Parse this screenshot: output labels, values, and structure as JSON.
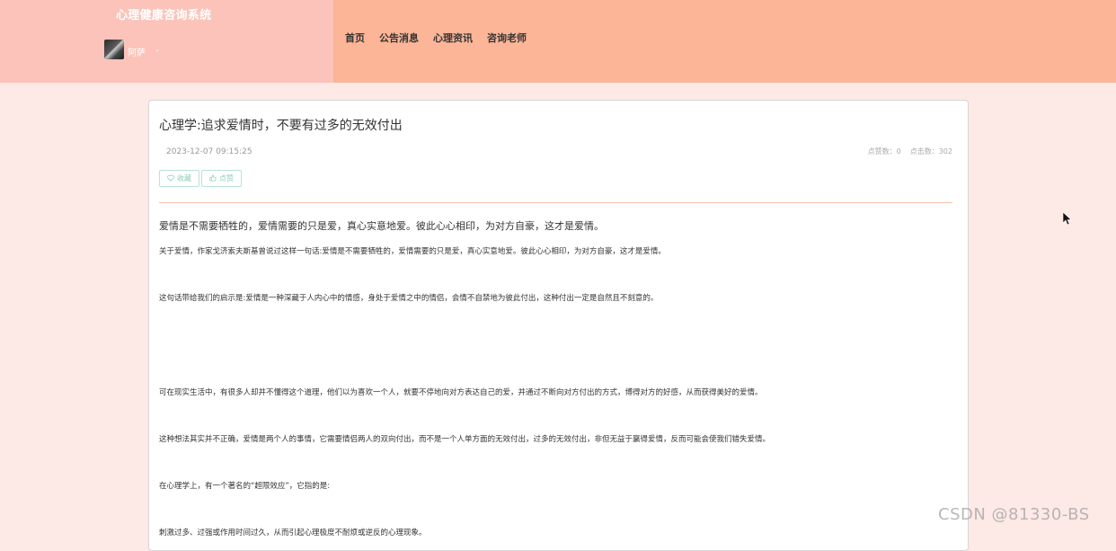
{
  "header": {
    "site_title": "心理健康咨询系统",
    "user_name": "阿萨",
    "user_caret": "⌄",
    "nav": [
      "首页",
      "公告消息",
      "心理资讯",
      "咨询老师"
    ]
  },
  "article": {
    "title": "心理学:追求爱情时，不要有过多的无效付出",
    "date": "2023-12-07 09:15:25",
    "likes_label": "点赞数：0",
    "views_label": "点击数：302",
    "collect_label": "收藏",
    "like_label": "点赞",
    "lead": "爱情是不需要牺牲的，爱情需要的只是爱，真心实意地爱。彼此心心相印，为对方自豪，这才是爱情。",
    "paragraphs": [
      "关于爱情，作家戈济索夫斯基曾说过这样一句话:爱情是不需要牺牲的，爱情需要的只是爱，真心实意地爱。彼此心心相印，为对方自豪，这才是爱情。",
      "这句话带给我们的启示是:爱情是一种深藏于人内心中的情感，身处于爱情之中的情侣，会情不自禁地为彼此付出，这种付出一定是自然且不刻意的。",
      "可在现实生活中，有很多人却并不懂得这个道理，他们以为喜欢一个人，就要不停地向对方表达自己的爱，并通过不断向对方付出的方式，博得对方的好感，从而获得美好的爱情。",
      "这种想法其实并不正确，爱情是两个人的事情，它需要情侣两人的双向付出，而不是一个人单方面的无效付出，过多的无效付出，非但无益于赢得爱情，反而可能会使我们错失爱情。",
      "在心理学上，有一个著名的“超限效应”，它指的是:",
      "刺激过多、过强或作用时间过久，从而引起心理极度不耐烦或逆反的心理现象。"
    ]
  },
  "watermark": "CSDN @81330-BS",
  "colors": {
    "header_bg": "#fcb597",
    "header_left_bg": "#fbc3b9",
    "page_bg": "#fde9e6",
    "divider": "#f3c3a8",
    "action_border": "#b9e3d3"
  }
}
